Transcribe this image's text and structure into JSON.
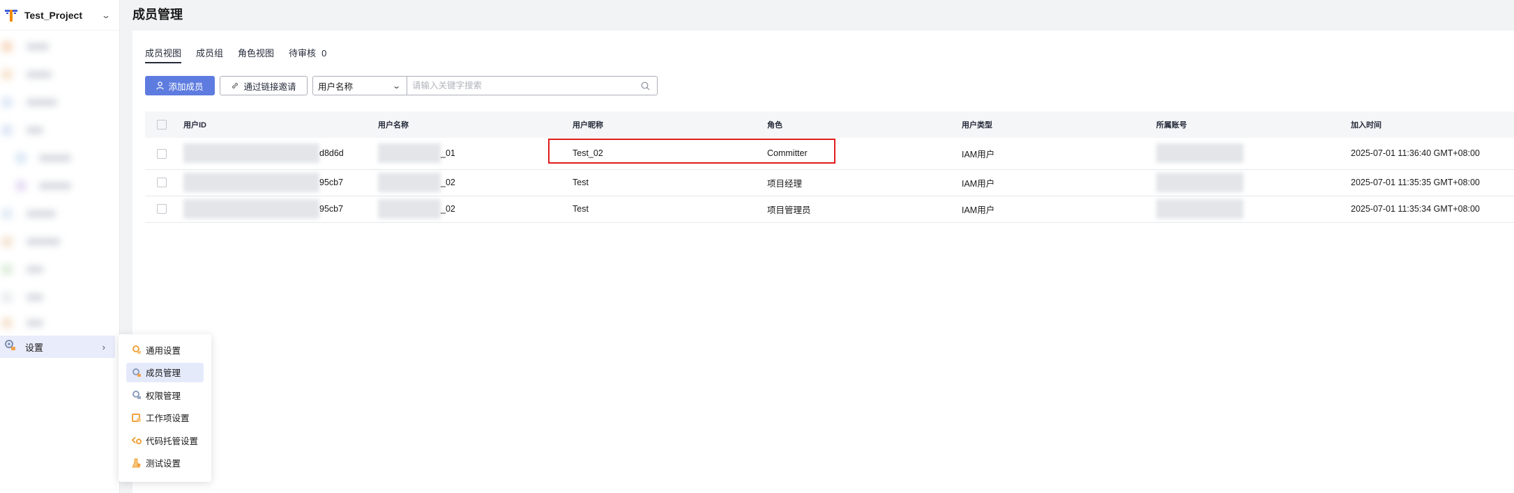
{
  "project": {
    "name": "Test_Project"
  },
  "sidebar": {
    "settings_label": "设置"
  },
  "submenu": {
    "items": [
      {
        "label": "通用设置",
        "icon": "general-settings-icon"
      },
      {
        "label": "成员管理",
        "icon": "member-management-icon",
        "active": true
      },
      {
        "label": "权限管理",
        "icon": "permission-management-icon"
      },
      {
        "label": "工作项设置",
        "icon": "work-item-settings-icon"
      },
      {
        "label": "代码托管设置",
        "icon": "code-hosting-settings-icon"
      },
      {
        "label": "测试设置",
        "icon": "test-settings-icon"
      }
    ]
  },
  "page": {
    "title": "成员管理"
  },
  "tabs": [
    {
      "label": "成员视图",
      "active": true
    },
    {
      "label": "成员组"
    },
    {
      "label": "角色视图"
    },
    {
      "label": "待审核",
      "count": "0"
    }
  ],
  "toolbar": {
    "add_member": "添加成员",
    "invite_link": "通过链接邀请",
    "filter_select": "用户名称",
    "search_placeholder": "请输入关键字搜索"
  },
  "table": {
    "headers": [
      "用户ID",
      "用户名称",
      "用户昵称",
      "角色",
      "用户类型",
      "所属账号",
      "加入时间"
    ],
    "rows": [
      {
        "id_tail": "d8d6d",
        "name_tail": "_01",
        "nickname": "Test_02",
        "role": "Committer",
        "type": "IAM用户",
        "joined": "2025-07-01 11:36:40 GMT+08:00"
      },
      {
        "id_tail": "95cb7",
        "name_tail": "_02",
        "nickname": "Test",
        "role": "项目经理",
        "type": "IAM用户",
        "joined": "2025-07-01 11:35:35 GMT+08:00"
      },
      {
        "id_tail": "95cb7",
        "name_tail": "_02",
        "nickname": "Test",
        "role": "项目管理员",
        "type": "IAM用户",
        "joined": "2025-07-01 11:35:34 GMT+08:00"
      }
    ]
  },
  "colors": {
    "primary": "#5e7ce0",
    "highlight": "#e01b1b",
    "active_bg": "#e5eafb"
  }
}
